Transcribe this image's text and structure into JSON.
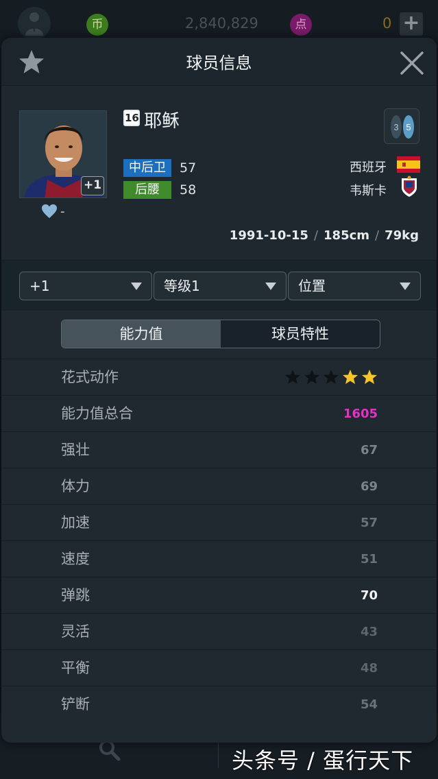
{
  "topbar": {
    "gold_icon": "币",
    "gold_value": "2,840,829",
    "points_icon": "点",
    "points_value": "0",
    "add_label": "+"
  },
  "modal": {
    "title": "球员信息"
  },
  "player": {
    "number": "16",
    "name": "耶稣",
    "level_badge": "+1",
    "favorite_count": "-",
    "positions": [
      {
        "label": "中后卫",
        "value": "57",
        "color": "#1b6fbe"
      },
      {
        "label": "后腰",
        "value": "58",
        "color": "#3f8a2a"
      }
    ],
    "weak_foot": "3",
    "strong_foot": "5",
    "nationality": "西班牙",
    "club": "韦斯卡",
    "birthdate": "1991-10-15",
    "height": "185cm",
    "weight": "79kg",
    "bio_separator": "/"
  },
  "filters": [
    {
      "label": "+1"
    },
    {
      "label": "等级1"
    },
    {
      "label": "位置"
    }
  ],
  "tabs": [
    {
      "label": "能力值",
      "active": true
    },
    {
      "label": "球员特性",
      "active": false
    }
  ],
  "skill_moves": {
    "label": "花式动作",
    "stars": 2,
    "max_stars": 5
  },
  "stats": [
    {
      "label": "能力值总合",
      "value": "1605",
      "color": "#e233c6"
    },
    {
      "label": "强壮",
      "value": "67",
      "color": "#7a8489"
    },
    {
      "label": "体力",
      "value": "69",
      "color": "#7a8489"
    },
    {
      "label": "加速",
      "value": "57",
      "color": "#6a7378"
    },
    {
      "label": "速度",
      "value": "51",
      "color": "#6a7378"
    },
    {
      "label": "弹跳",
      "value": "70",
      "color": "#f2f4f5"
    },
    {
      "label": "灵活",
      "value": "43",
      "color": "#5e676c"
    },
    {
      "label": "平衡",
      "value": "48",
      "color": "#5e676c"
    },
    {
      "label": "铲断",
      "value": "54",
      "color": "#6a7378"
    }
  ],
  "colors": {
    "star_on": "#f7c52b",
    "star_off": "#0d1317",
    "accent_total": "#e233c6"
  },
  "watermark": "头条号 / 蛋行天下"
}
